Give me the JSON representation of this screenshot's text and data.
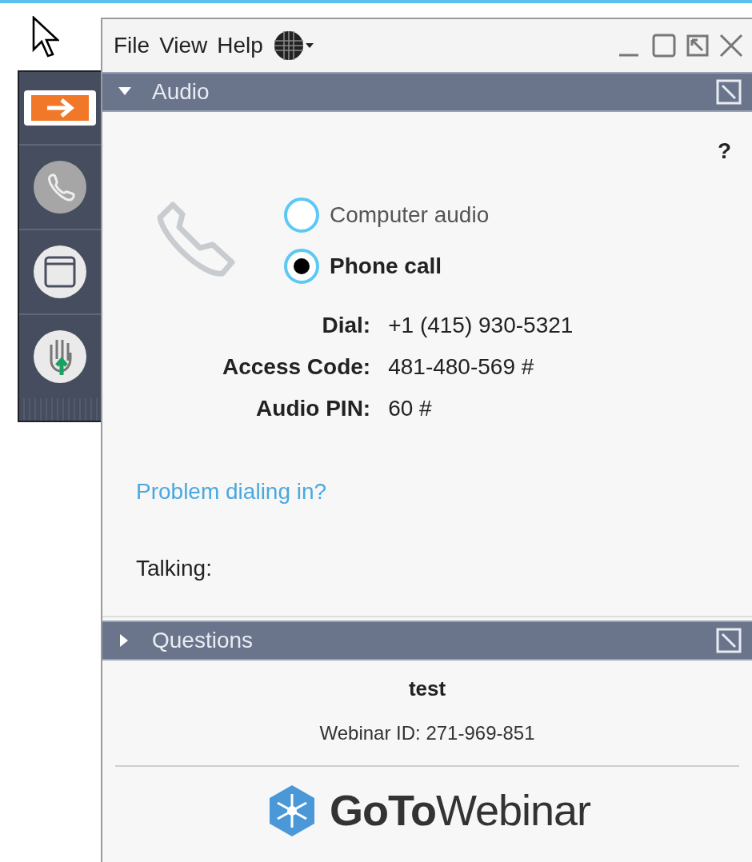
{
  "menu": [
    {
      "label": "File"
    },
    {
      "label": "View"
    },
    {
      "label": "Help"
    }
  ],
  "toolbar": [
    {
      "kind": "toggle"
    },
    {
      "kind": "phone"
    },
    {
      "kind": "window"
    },
    {
      "kind": "hand"
    }
  ],
  "audio": {
    "title": "Audio",
    "expanded": true,
    "help": "?",
    "options": [
      {
        "label": "Computer audio",
        "selected": false
      },
      {
        "label": "Phone call",
        "selected": true
      }
    ],
    "fields": [
      {
        "label": "Dial:",
        "value": "+1 (415) 930-5321"
      },
      {
        "label": "Access Code:",
        "value": "481-480-569 #"
      },
      {
        "label": "Audio PIN:",
        "value": "60 #"
      }
    ],
    "link": "Problem dialing in?",
    "talking": "Talking:"
  },
  "questions": {
    "title": "Questions",
    "expanded": false
  },
  "webinar": {
    "title": "test",
    "id": "Webinar ID: 271-969-851",
    "brand": "**GoTo**Webinar"
  }
}
